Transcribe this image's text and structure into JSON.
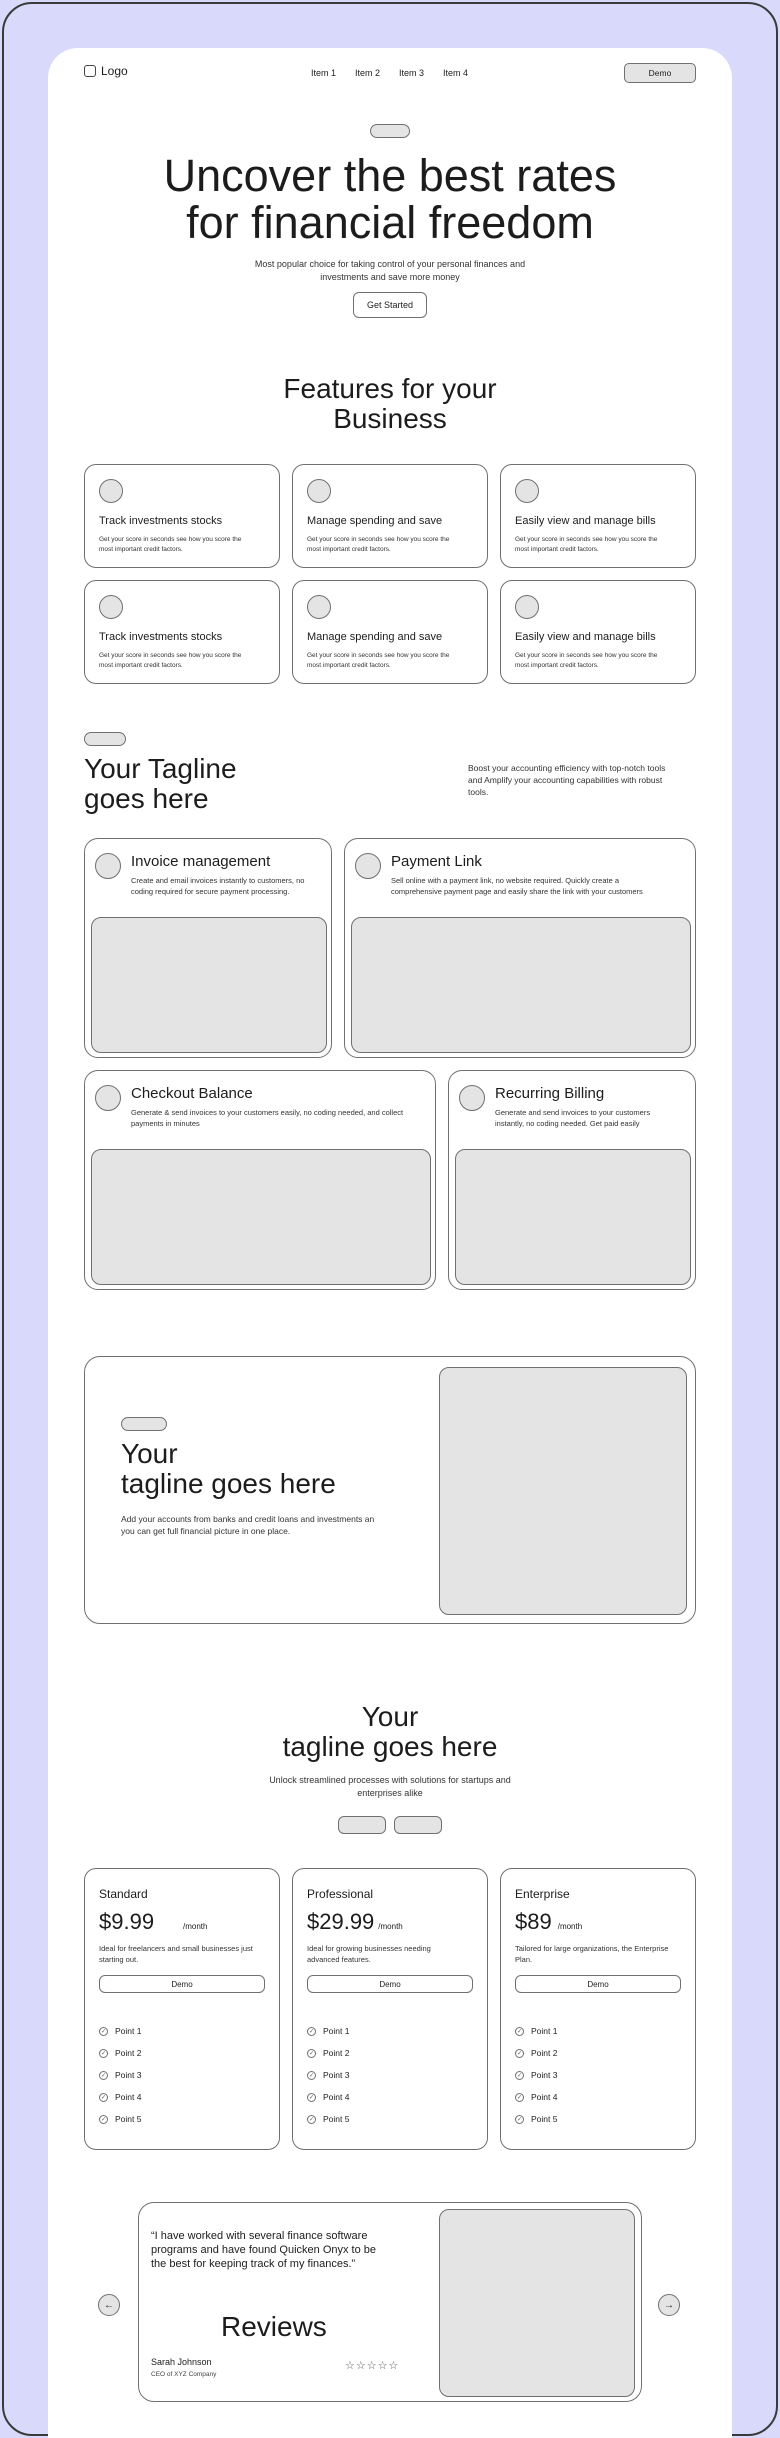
{
  "header": {
    "logo": "Logo",
    "nav": [
      "Item 1",
      "Item 2",
      "Item 3",
      "Item 4"
    ],
    "cta": "Demo"
  },
  "hero": {
    "title_line1": "Uncover the best rates",
    "title_line2": "for financial freedom",
    "subtitle_line1": "Most popular choice for taking control of your personal finances and",
    "subtitle_line2": "investments and save more money",
    "cta": "Get Started"
  },
  "features": {
    "title_line1": "Features for your",
    "title_line2": "Business",
    "cards": [
      {
        "title": "Track investments stocks",
        "desc1": "Get your score in seconds see how you score the",
        "desc2": "most important credit factors."
      },
      {
        "title": "Manage spending and save",
        "desc1": "Get your score in seconds see how you score the",
        "desc2": "most important credit factors."
      },
      {
        "title": "Easily view and manage bills",
        "desc1": "Get your score in seconds see how you score the",
        "desc2": "most important credit factors."
      },
      {
        "title": "Track investments stocks",
        "desc1": "Get your score in seconds see how you score the",
        "desc2": "most important credit factors."
      },
      {
        "title": "Manage spending and save",
        "desc1": "Get your score in seconds see how you score the",
        "desc2": "most important credit factors."
      },
      {
        "title": "Easily view and manage bills",
        "desc1": "Get your score in seconds see how you score the",
        "desc2": "most important credit factors."
      }
    ]
  },
  "tagline": {
    "title_line1": "Your Tagline",
    "title_line2": "goes here",
    "desc1": "Boost your accounting efficiency with top-notch tools",
    "desc2": "and Amplify your accounting capabilities with robust",
    "desc3": "tools.",
    "products": [
      {
        "title": "Invoice management",
        "desc1": "Create and email invoices instantly to customers, no",
        "desc2": "coding required for secure payment processing."
      },
      {
        "title": "Payment Link",
        "desc1": "Sell online with a payment link, no website required. Quickly create a",
        "desc2": "comprehensive payment page and easily share the link with your customers"
      },
      {
        "title": "Checkout Balance",
        "desc1": "Generate & send invoices to your customers easily, no coding needed, and collect",
        "desc2": "payments in minutes"
      },
      {
        "title": "Recurring Billing",
        "desc1": "Generate and send invoices to your customers",
        "desc2": "instantly, no coding needed. Get paid easily"
      }
    ]
  },
  "banner": {
    "title_line1": "Your",
    "title_line2": "tagline goes here",
    "desc1": "Add your accounts from banks and credit loans and investments an",
    "desc2": "you can get  full financial picture in one place."
  },
  "pricing": {
    "title_line1": "Your",
    "title_line2": "tagline goes here",
    "subtitle1": "Unlock streamlined processes with solutions for startups and",
    "subtitle2": "enterprises alike",
    "plans": [
      {
        "name": "Standard",
        "price": "$9.99",
        "period": "/month",
        "desc1": "Ideal for freelancers and small businesses just",
        "desc2": "starting out.",
        "cta": "Demo",
        "points": [
          "Point 1",
          "Point 2",
          "Point 3",
          "Point 4",
          "Point 5"
        ]
      },
      {
        "name": "Professional",
        "price": "$29.99",
        "period": "/month",
        "desc1": "Ideal for growing businesses needing",
        "desc2": "advanced features.",
        "cta": "Demo",
        "points": [
          "Point 1",
          "Point 2",
          "Point 3",
          "Point 4",
          "Point 5"
        ]
      },
      {
        "name": "Enterprise",
        "price": "$89",
        "period": "/month",
        "desc1": "Tailored for large organizations, the Enterprise",
        "desc2": "Plan.",
        "cta": "Demo",
        "points": [
          "Point 1",
          "Point 2",
          "Point 3",
          "Point 4",
          "Point 5"
        ]
      }
    ]
  },
  "reviews": {
    "quote1": "“I have worked with several finance software",
    "quote2": "programs and have found Quicken Onyx to be",
    "quote3": "the best for keeping track of my finances.”",
    "title": "Reviews",
    "name": "Sarah Johnson",
    "role": "CEO of XYZ Company",
    "stars": "☆☆☆☆☆",
    "prev": "←",
    "next": "→"
  }
}
